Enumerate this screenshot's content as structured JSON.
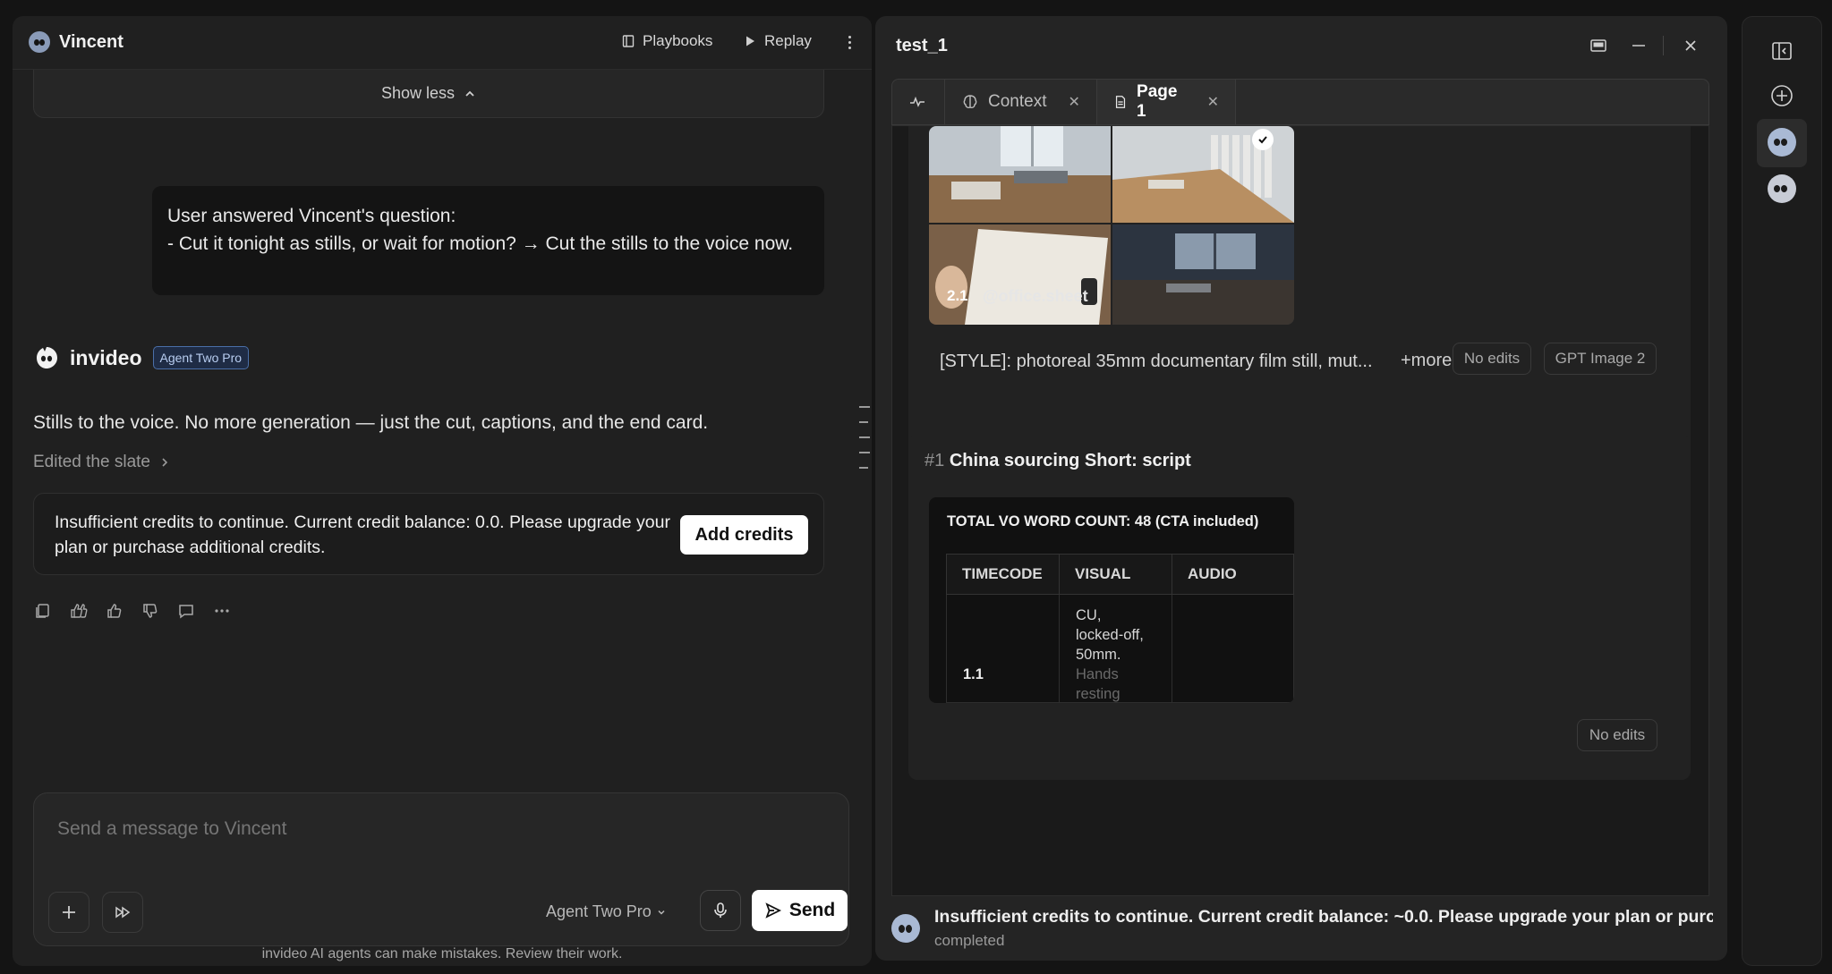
{
  "chat": {
    "agent_name": "Vincent",
    "header_buttons": {
      "playbooks": "Playbooks",
      "replay": "Replay"
    },
    "show_less": "Show less",
    "user_message": {
      "line1": "User answered Vincent's question:",
      "line2": "- Cut it tonight as stills, or wait for motion? → Cut the stills to the voice now."
    },
    "reply": {
      "brand": "invideo",
      "badge": "Agent Two Pro",
      "text": "Stills to the voice. No more generation — just the cut, captions, and the end card.",
      "edited": "Edited the slate"
    },
    "credit_notice": {
      "text": "Insufficient credits to continue. Current credit balance: 0.0. Please upgrade your plan or purchase additional credits.",
      "button": "Add credits"
    },
    "actions": [
      "copy-icon",
      "double-thumbs-up-icon",
      "thumbs-up-icon",
      "thumbs-down-icon",
      "comment-icon",
      "more-icon"
    ],
    "composer": {
      "placeholder": "Send a message to Vincent",
      "model": "Agent Two Pro",
      "send": "Send"
    },
    "disclaimer": "invideo AI agents can make mistakes. Review their work."
  },
  "panel": {
    "title": "test_1",
    "tabs": [
      {
        "label": "",
        "icon": "activity-icon"
      },
      {
        "label": "Context",
        "icon": "brain-icon",
        "closable": true
      },
      {
        "label": "Page 1",
        "icon": "page-icon",
        "closable": true,
        "active": true
      }
    ],
    "shot": {
      "number": "2.1",
      "tag": "@office.sheet",
      "style": "[STYLE]: photoreal 35mm documentary film still, mut...",
      "more": "+more",
      "edits": "No edits",
      "model": "GPT Image 2"
    },
    "script": {
      "hash": "#1",
      "title": "China sourcing Short: script",
      "vo_count": "TOTAL VO WORD COUNT: 48 (CTA included)",
      "columns": [
        "TIMECODE",
        "VISUAL",
        "AUDIO"
      ],
      "row": {
        "id": "1.1",
        "visual_lines": [
          "CU,",
          "locked-off,",
          "50mm."
        ],
        "visual_faded": [
          "Hands",
          "resting"
        ],
        "audio": ""
      },
      "edits": "No edits"
    },
    "status": {
      "message": "Insufficient credits to continue. Current credit balance: ~0.0. Please upgrade your plan or purch...",
      "state": "completed"
    }
  },
  "colors": {
    "background": "#141414",
    "panel": "#202020",
    "accent_badge": "#4a6fa8",
    "button_primary": "#ffffff"
  }
}
